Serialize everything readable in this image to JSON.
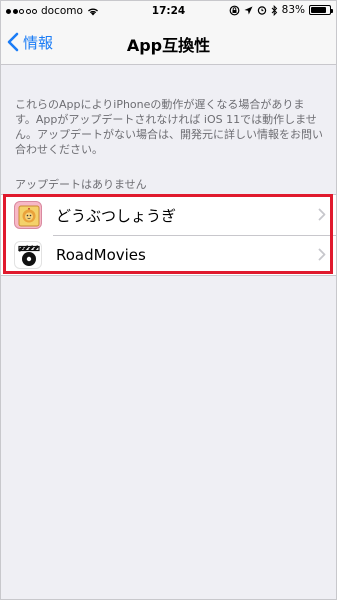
{
  "status_bar": {
    "carrier": "docomo",
    "time": "17:24",
    "battery_percent": "83%",
    "battery_level": 0.83,
    "signal_bars_on": 2,
    "signal_bars_total": 5
  },
  "nav": {
    "back_label": "情報",
    "title": "App互換性"
  },
  "note": {
    "lines": [
      "これらのAppによりiPhoneの動作が遅くなる場合がありま",
      "す。Appがアップデートされなければ iOS 11では動作しませ",
      "ん。アップデートがない場合は、開発元に詳しい情報をお問い",
      "合わせください。"
    ]
  },
  "section": {
    "header": "アップデートはありません"
  },
  "apps": [
    {
      "name": "どうぶつしょうぎ",
      "icon": "doubutsu-shogi-icon"
    },
    {
      "name": "RoadMovies",
      "icon": "roadmovies-icon"
    }
  ],
  "colors": {
    "accent": "#1a7cf6",
    "background": "#efeff4",
    "highlight": "#e0192d"
  }
}
